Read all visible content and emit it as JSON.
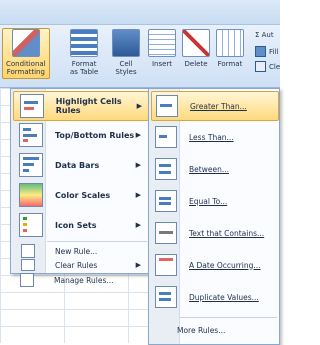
{
  "ribbon": {
    "conditional_formatting": "Conditional\nFormatting",
    "format_as_table": "Format\nas Table",
    "cell_styles": "Cell\nStyles",
    "insert": "Insert",
    "delete": "Delete",
    "format": "Format",
    "autosum": "Σ Aut",
    "fill": "Fill",
    "clear": "Cle"
  },
  "menu": {
    "items": [
      {
        "label": "Highlight Cells Rules",
        "has_submenu": true,
        "icon": "highlight-cells-icon"
      },
      {
        "label": "Top/Bottom Rules",
        "has_submenu": true,
        "icon": "top-bottom-icon"
      },
      {
        "label": "Data Bars",
        "has_submenu": true,
        "icon": "data-bars-icon"
      },
      {
        "label": "Color Scales",
        "has_submenu": true,
        "icon": "color-scales-icon"
      },
      {
        "label": "Icon Sets",
        "has_submenu": true,
        "icon": "icon-sets-icon"
      }
    ],
    "small_items": [
      {
        "label": "New Rule...",
        "icon": "new-rule-icon"
      },
      {
        "label": "Clear Rules",
        "has_submenu": true,
        "icon": "clear-rules-icon"
      },
      {
        "label": "Manage Rules...",
        "icon": "manage-rules-icon"
      }
    ]
  },
  "submenu": {
    "items": [
      {
        "label": "Greater Than...",
        "icon": "greater-than-icon"
      },
      {
        "label": "Less Than...",
        "icon": "less-than-icon"
      },
      {
        "label": "Between...",
        "icon": "between-icon"
      },
      {
        "label": "Equal To...",
        "icon": "equal-to-icon"
      },
      {
        "label": "Text that Contains...",
        "icon": "text-contains-icon"
      },
      {
        "label": "A Date Occurring...",
        "icon": "date-occurring-icon"
      },
      {
        "label": "Duplicate Values...",
        "icon": "duplicate-values-icon"
      }
    ],
    "more": "More Rules..."
  }
}
